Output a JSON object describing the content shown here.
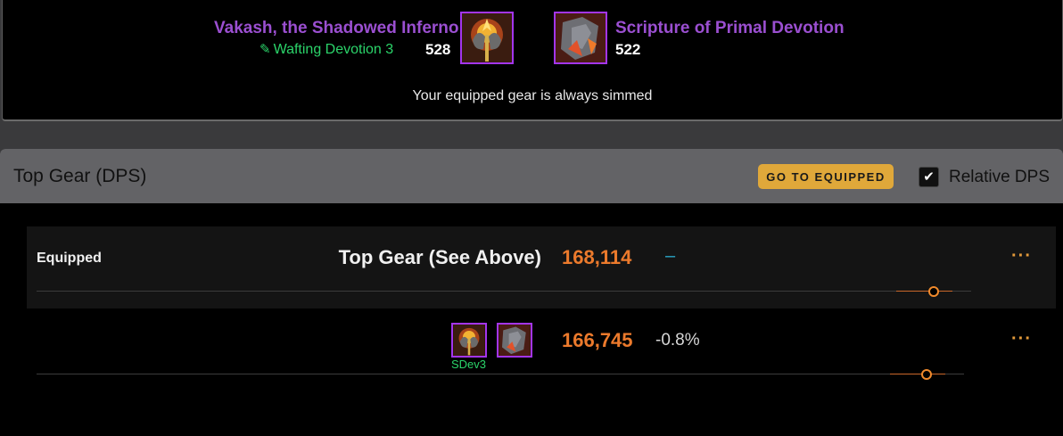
{
  "equipped": {
    "weapon": {
      "name": "Vakash, the Shadowed Inferno",
      "ilvl": "528",
      "enchant": "Wafting Devotion 3",
      "icon": "fiery-axe-icon"
    },
    "offhand": {
      "name": "Scripture of Primal Devotion",
      "ilvl": "522",
      "icon": "stone-tome-icon"
    },
    "note": "Your equipped gear is always simmed"
  },
  "results": {
    "title": "Top Gear (DPS)",
    "goto_label": "GO TO EQUIPPED",
    "relative_label": "Relative DPS",
    "relative_checked": true,
    "rows": [
      {
        "label": "Equipped",
        "set_name": "Top Gear (See Above)",
        "dps": "168,114",
        "delta": "–",
        "more": "···"
      },
      {
        "label": "",
        "icon_label": "SDev3",
        "dps": "166,745",
        "delta": "-0.8%",
        "more": "···"
      }
    ]
  },
  "colors": {
    "epic": "#9b4fd1",
    "dps": "#ec7a2c",
    "enchant": "#2bd46a",
    "accent_button": "#e0a83a"
  }
}
